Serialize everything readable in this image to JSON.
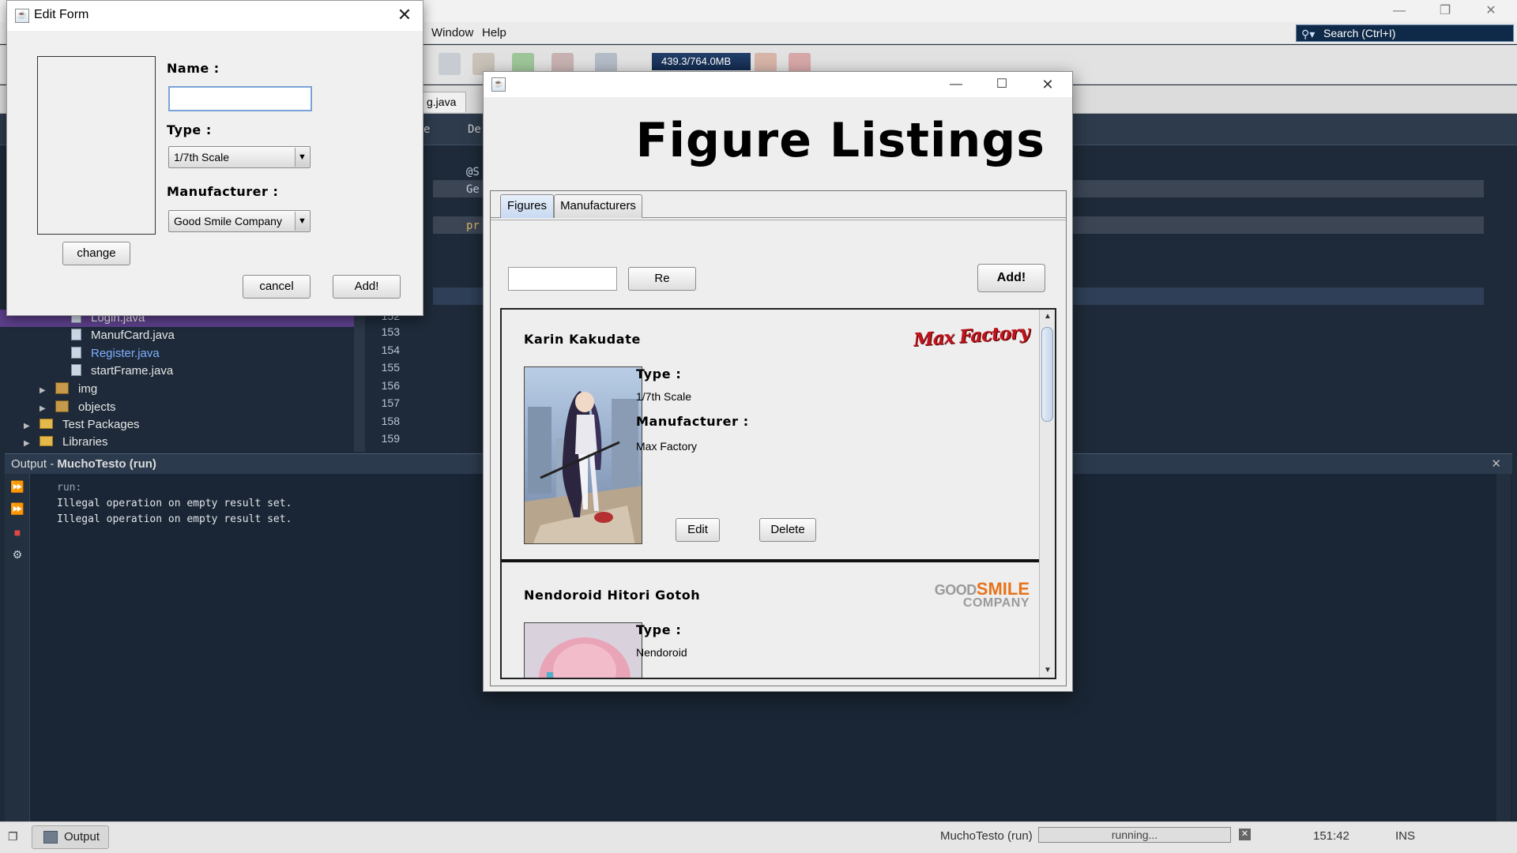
{
  "ide": {
    "menu": [
      "Window",
      "Help"
    ],
    "search_placeholder": "Search (Ctrl+I)",
    "memory": "439.3/764.0MB",
    "editor_tab": "g.java",
    "editor_subtabs": [
      "e",
      "De"
    ],
    "code_fragments": [
      "@S",
      "Ge",
      "pr"
    ],
    "project_tree": [
      {
        "label": "Login.java",
        "kind": "file"
      },
      {
        "label": "ManufCard.java",
        "kind": "file"
      },
      {
        "label": "Register.java",
        "kind": "file"
      },
      {
        "label": "startFrame.java",
        "kind": "file"
      },
      {
        "label": "img",
        "kind": "package"
      },
      {
        "label": "objects",
        "kind": "package"
      },
      {
        "label": "Test Packages",
        "kind": "folder"
      },
      {
        "label": "Libraries",
        "kind": "folder"
      }
    ],
    "line_numbers": [
      "152",
      "153",
      "154",
      "155",
      "156",
      "157",
      "158",
      "159"
    ],
    "output": {
      "title_prefix": "Output - ",
      "title_project": "MuchoTesto (run)",
      "lines": [
        "run:",
        "Illegal operation on empty result set.",
        "Illegal operation on empty result set."
      ]
    },
    "status": {
      "output_button": "Output",
      "project": "MuchoTesto (run)",
      "progress": "running...",
      "position": "151:42",
      "mode": "INS"
    },
    "colors": {
      "accent": "#2a5a9a",
      "editor_bg": "#1e2a39",
      "selected_tree": "#5b3f8a"
    }
  },
  "edit_form": {
    "title": "Edit Form",
    "name_label": "Name :",
    "name_value": "",
    "type_label": "Type :",
    "type_value": "1/7th Scale",
    "manufacturer_label": "Manufacturer :",
    "manufacturer_value": "Good Smile Company",
    "change_button": "change",
    "cancel_button": "cancel",
    "add_button": "Add!"
  },
  "listings": {
    "title": "Figure Listings",
    "tabs": [
      "Figures",
      "Manufacturers"
    ],
    "active_tab": "Figures",
    "search_value": "",
    "refresh_button": "Re",
    "add_button": "Add!",
    "cards": [
      {
        "name": "Karin Kakudate",
        "type_label": "Type :",
        "type": "1/7th Scale",
        "manufacturer_label": "Manufacturer :",
        "manufacturer": "Max Factory",
        "logo_text": "Max Factory",
        "edit_button": "Edit",
        "delete_button": "Delete"
      },
      {
        "name": "Nendoroid Hitori Gotoh",
        "type_label": "Type :",
        "type": "Nendoroid",
        "logo_good": "GOOD",
        "logo_smile": "SMILE",
        "logo_company": "COMPANY"
      }
    ]
  }
}
